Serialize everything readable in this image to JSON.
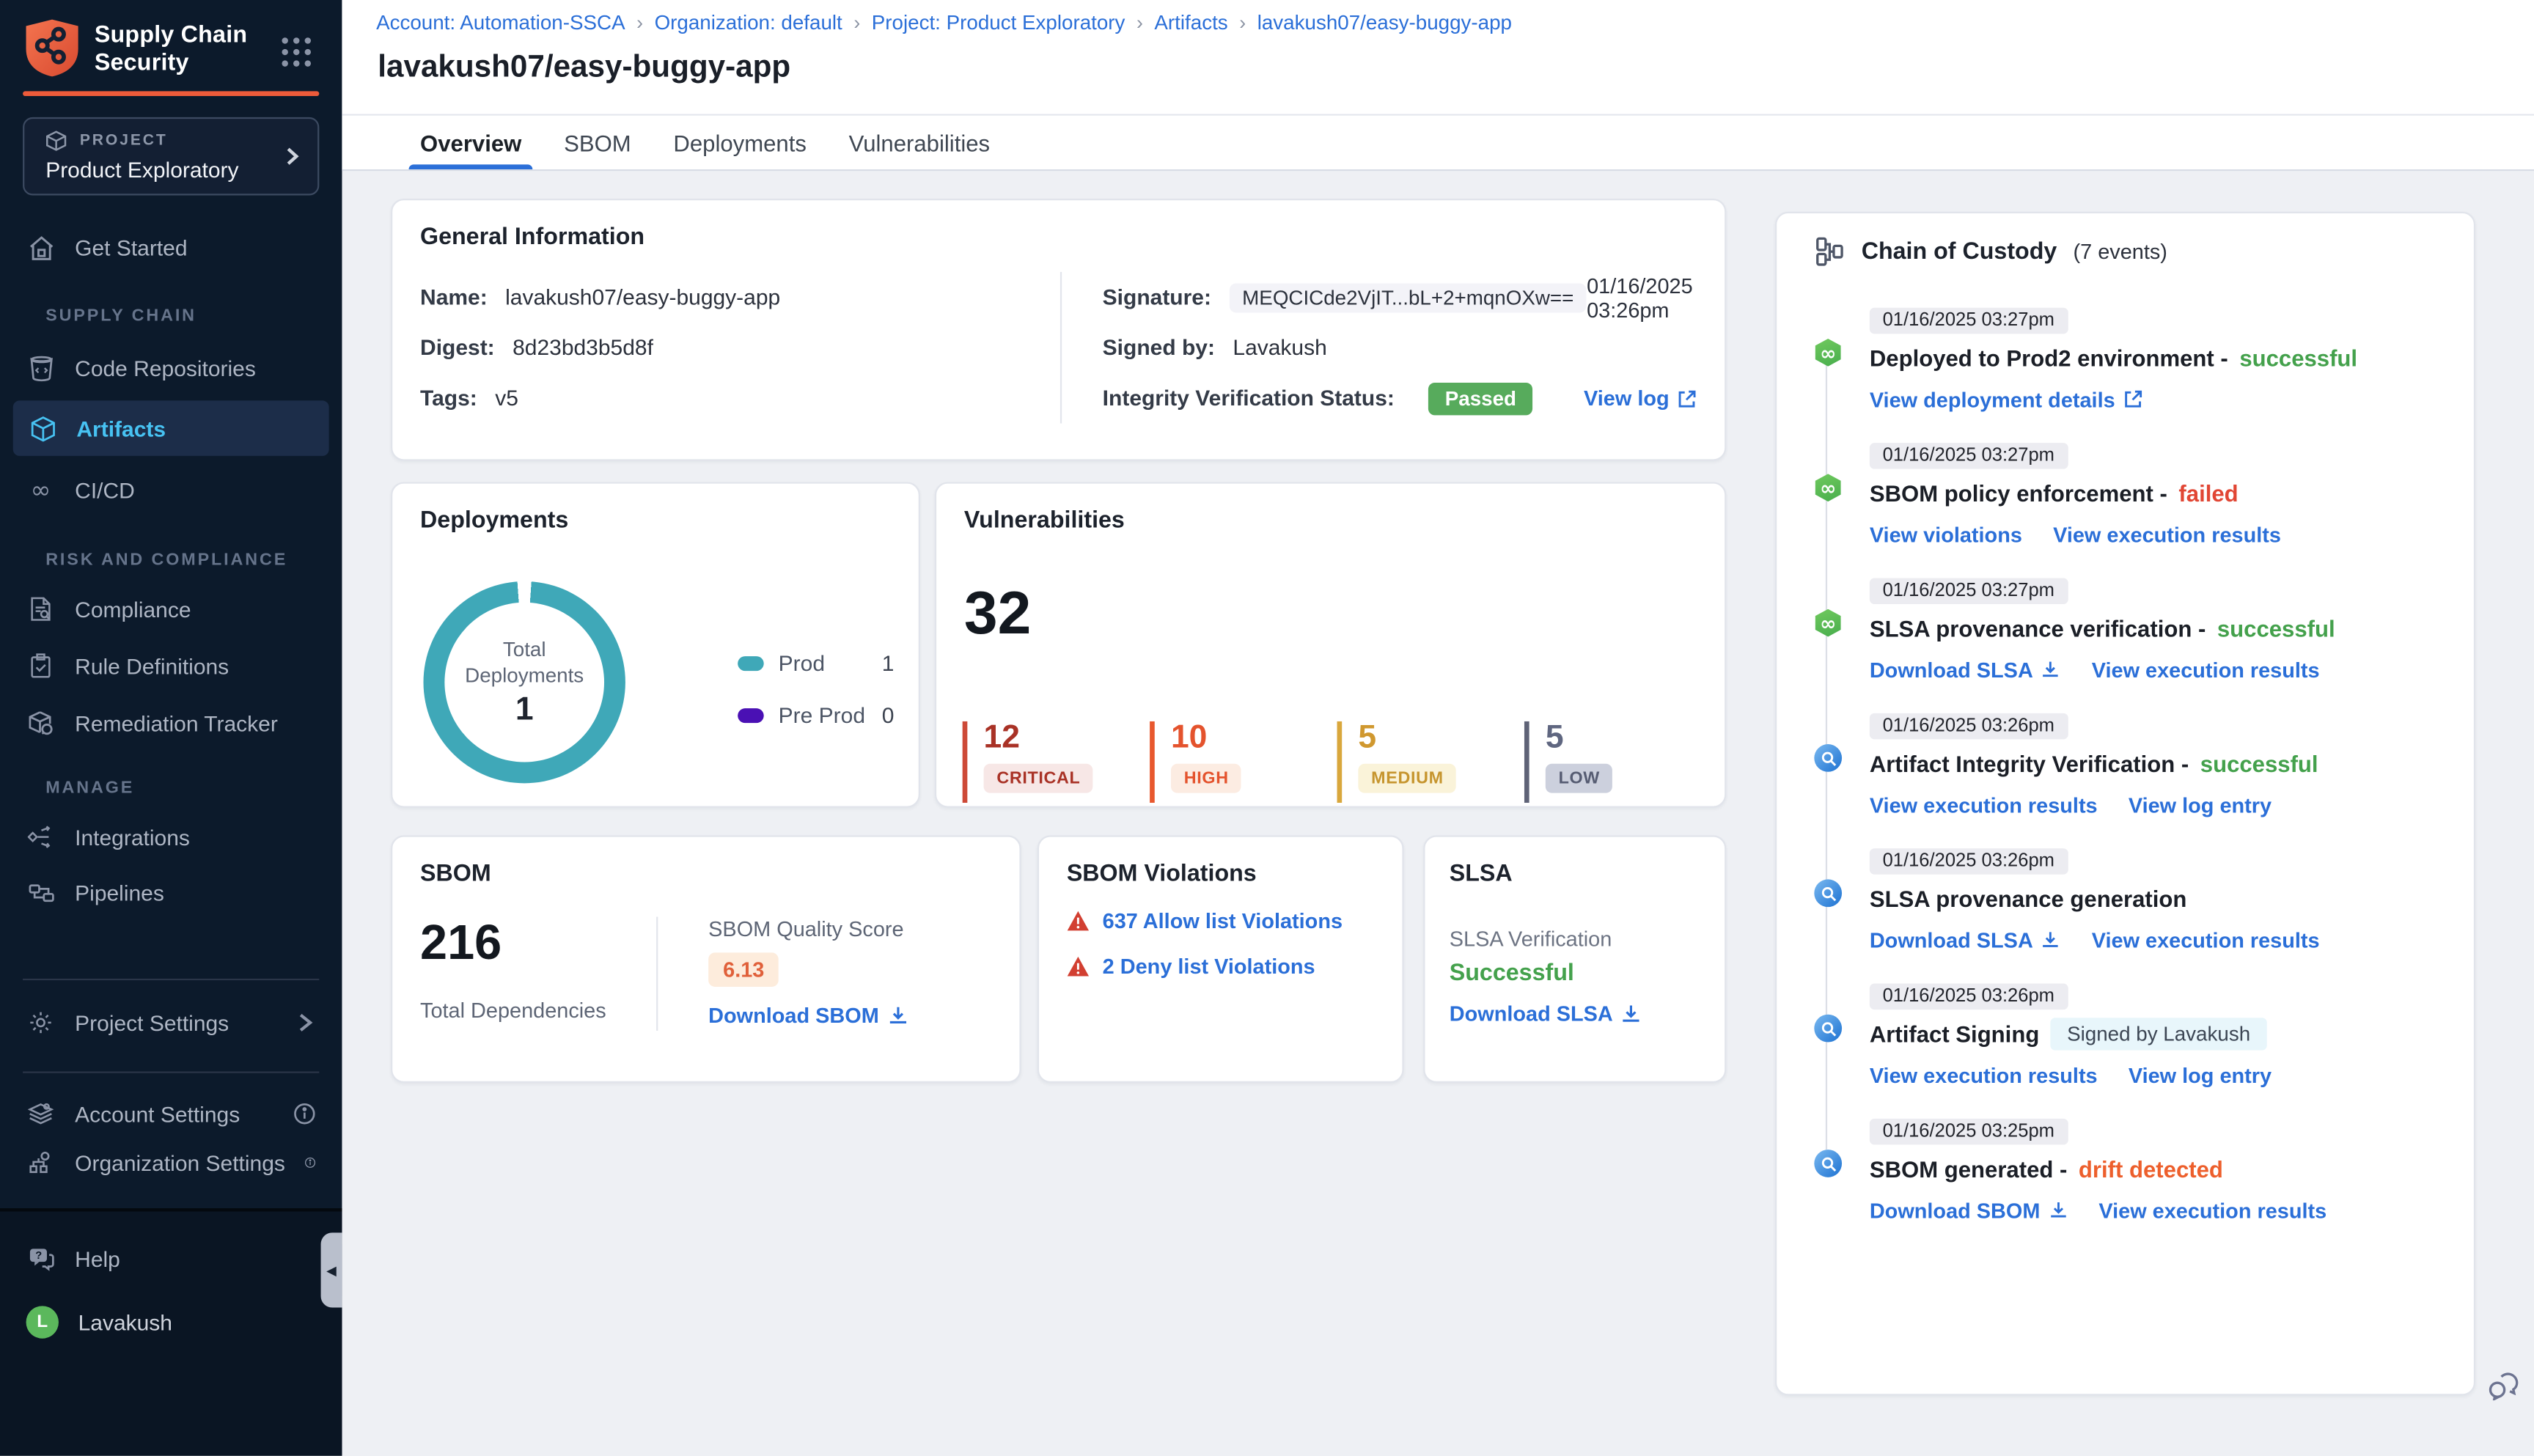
{
  "colors": {
    "brand_orange": "#ee5b3a",
    "sidebar_navy": "#0c1a2b",
    "link_blue": "#2b6fd8",
    "success_green": "#44a14c",
    "failed_red": "#e14634",
    "drift_orange": "#ed5f2c",
    "prod_teal": "#3fa8b8",
    "preprod_purple": "#4a10b4",
    "critical_red": "#a93226",
    "high_orange": "#e4532d",
    "medium_amber": "#d0982f",
    "low_slate": "#5f6680",
    "passed_badge_green": "#57ab5c"
  },
  "sidebar": {
    "app_title": "Supply Chain Security",
    "project_label": "PROJECT",
    "project_name": "Product Exploratory",
    "nav_get_started": "Get Started",
    "section_supply_chain": "SUPPLY CHAIN",
    "nav_code_repositories": "Code Repositories",
    "nav_artifacts": "Artifacts",
    "nav_cicd": "CI/CD",
    "section_risk": "RISK AND COMPLIANCE",
    "nav_compliance": "Compliance",
    "nav_rule_definitions": "Rule Definitions",
    "nav_remediation_tracker": "Remediation Tracker",
    "section_manage": "MANAGE",
    "nav_integrations": "Integrations",
    "nav_pipelines": "Pipelines",
    "nav_project_settings": "Project Settings",
    "nav_account_settings": "Account Settings",
    "nav_organization_settings": "Organization Settings",
    "nav_help": "Help",
    "user_name": "Lavakush",
    "user_initial": "L"
  },
  "breadcrumb": {
    "separator": "›",
    "items": [
      "Account: Automation-SSCA",
      "Organization: default",
      "Project: Product Exploratory",
      "Artifacts",
      "lavakush07/easy-buggy-app"
    ]
  },
  "page": {
    "title": "lavakush07/easy-buggy-app",
    "tabs": [
      "Overview",
      "SBOM",
      "Deployments",
      "Vulnerabilities"
    ]
  },
  "general_info": {
    "title": "General Information",
    "name_label": "Name:",
    "name": "lavakush07/easy-buggy-app",
    "digest_label": "Digest:",
    "digest": "8d23bd3b5d8f",
    "tags_label": "Tags:",
    "tags": "v5",
    "signature_label": "Signature:",
    "signature": "MEQCICde2VjIT...bL+2+mqnOXw==",
    "signature_date": "01/16/2025 03:26pm",
    "signed_by_label": "Signed by:",
    "signed_by": "Lavakush",
    "integrity_label": "Integrity Verification Status:",
    "integrity_status": "Passed",
    "view_log_label": "View log"
  },
  "deployments": {
    "title": "Deployments",
    "center_label": "Total Deployments",
    "total": "1",
    "chart": {
      "type": "donut",
      "series": [
        {
          "name": "Prod",
          "value": 1
        },
        {
          "name": "Pre Prod",
          "value": 0
        }
      ]
    },
    "legend": [
      {
        "label": "Prod",
        "value": "1"
      },
      {
        "label": "Pre Prod",
        "value": "0"
      }
    ]
  },
  "vulnerabilities": {
    "title": "Vulnerabilities",
    "total": "32",
    "severities": [
      {
        "count": "12",
        "label": "CRITICAL"
      },
      {
        "count": "10",
        "label": "HIGH"
      },
      {
        "count": "5",
        "label": "MEDIUM"
      },
      {
        "count": "5",
        "label": "LOW"
      }
    ]
  },
  "sbom": {
    "title": "SBOM",
    "total_dependencies": "216",
    "total_label": "Total Dependencies",
    "quality_label": "SBOM Quality Score",
    "quality_score": "6.13",
    "download_label": "Download SBOM"
  },
  "sbom_violations": {
    "title": "SBOM Violations",
    "allow_link": "637 Allow list Violations",
    "deny_link": "2 Deny list Violations"
  },
  "slsa": {
    "title": "SLSA",
    "verification_label": "SLSA Verification",
    "status": "Successful",
    "download_label": "Download SLSA"
  },
  "chain_of_custody": {
    "title": "Chain of Custody",
    "events_label": "(7 events)",
    "events": [
      {
        "time": "01/16/2025 03:27pm",
        "title": "Deployed to Prod2 environment -",
        "status": "successful",
        "links": [
          "View deployment details"
        ]
      },
      {
        "time": "01/16/2025 03:27pm",
        "title": "SBOM policy enforcement -",
        "status": "failed",
        "links": [
          "View violations",
          "View execution results"
        ]
      },
      {
        "time": "01/16/2025 03:27pm",
        "title": "SLSA provenance verification -",
        "status": "successful",
        "links": [
          "Download SLSA",
          "View execution results"
        ]
      },
      {
        "time": "01/16/2025 03:26pm",
        "title": "Artifact Integrity Verification -",
        "status": "successful",
        "links": [
          "View execution results",
          "View log entry"
        ]
      },
      {
        "time": "01/16/2025 03:26pm",
        "title": "SLSA provenance generation",
        "status": "",
        "links": [
          "Download SLSA",
          "View execution results"
        ]
      },
      {
        "time": "01/16/2025 03:26pm",
        "title": "Artifact Signing",
        "status": "",
        "badge": "Signed by Lavakush",
        "links": [
          "View execution results",
          "View log entry"
        ]
      },
      {
        "time": "01/16/2025 03:25pm",
        "title": "SBOM generated -",
        "status": "drift detected",
        "links": [
          "Download SBOM",
          "View execution results"
        ]
      }
    ]
  }
}
